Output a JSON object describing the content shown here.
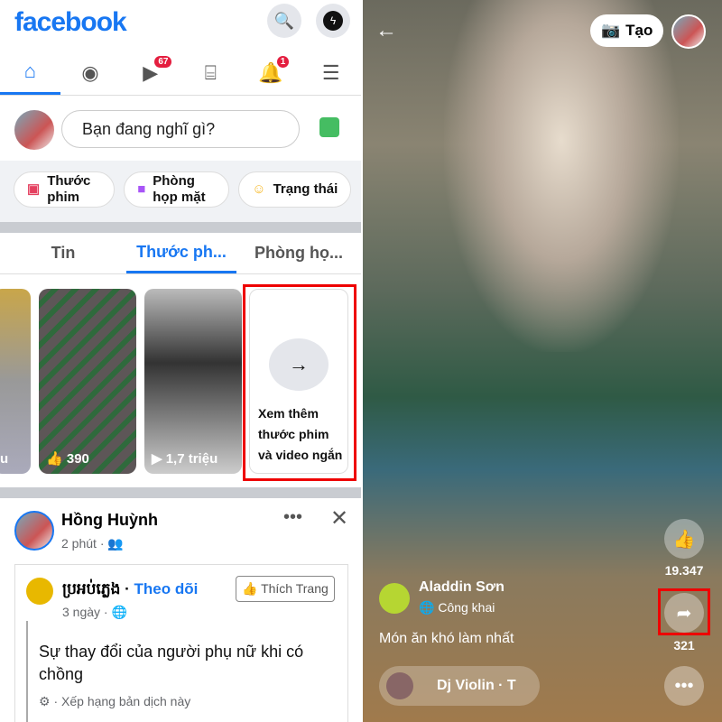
{
  "left": {
    "logo": "facebook",
    "nav": {
      "watch_badge": "67",
      "notif_badge": "1"
    },
    "composer_placeholder": "Bạn đang nghĩ gì?",
    "chips": [
      "Thước phim",
      "Phòng họp mặt",
      "Trạng thái"
    ],
    "tabs": [
      "Tin",
      "Thước ph...",
      "Phòng họ..."
    ],
    "reels": [
      {
        "stat": "u"
      },
      {
        "stat": "390"
      },
      {
        "stat": "1,7 triệu"
      }
    ],
    "see_more": "Xem thêm thước phim và video ngắn",
    "post": {
      "author": "Hồng Huỳnh",
      "time": "2 phút",
      "shared_page": "ប្រអប់ភ្លេង",
      "follow": "Theo dõi",
      "like_page": "Thích Trang",
      "shared_time": "3 ngày",
      "text": "Sự thay đổi của người phụ nữ khi có chồng",
      "translate": "Xếp hạng bản dịch này"
    }
  },
  "right": {
    "create": "Tạo",
    "author": "Aladdin Sơn",
    "privacy": "Công khai",
    "caption": "Món ăn khó làm nhất",
    "likes": "19.347",
    "shares": "321",
    "music": "Dj Violin · T"
  },
  "colors": {
    "brand": "#1877f2",
    "highlight": "#e00000"
  }
}
